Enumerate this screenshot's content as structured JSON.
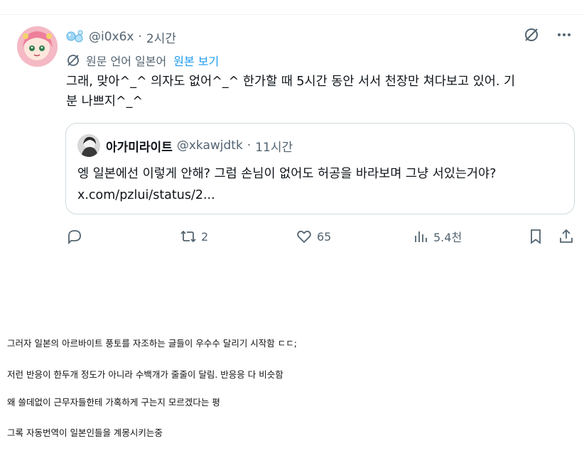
{
  "tweet": {
    "handle": "@i0x6x",
    "separator": "·",
    "time": "2시간",
    "translation": {
      "label": "원문 언어 일본어",
      "show_original": "원본 보기"
    },
    "text": "그래, 맞아^_^ 의자도 없어^_^ 한가할 때 5시간 동안 서서 천장만 쳐다보고 있어. 기\n분 나쁘지^_^",
    "quote": {
      "name": "아가미라이트",
      "handle": "@xkawjdtk",
      "separator": "·",
      "time": "11시간",
      "text_line1": "엥 일본에선 이렇게 안해? 그럼 손님이 없어도 허공을 바라보며 그냥 서있는거야?",
      "text_line2": "x.com/pzlui/status/2..."
    },
    "actions": {
      "reply_count": "",
      "retweet_count": "2",
      "like_count": "65",
      "view_count": "5.4천"
    }
  },
  "caption": {
    "lines": [
      "그러자 일본의 아르바이트 풍토를 자조하는 글들이 우수수 달리기 시작함 ㄷㄷ;",
      "저런 반응이 한두개 정도가 아니라 수백개가 줄줄이 달림. 반응응 다 비슷함",
      "왜 쓸데없이 근무자들한테 가혹하게 구는지 모르겠다는 평",
      "그록 자동번역이 일본인들을 계몽시키는중"
    ]
  },
  "icons": {
    "name_emoji": "bubbles-icon",
    "no_translate": "translate-off-icon",
    "more": "more-icon",
    "globe": "translate-icon",
    "reply": "reply-icon",
    "retweet": "retweet-icon",
    "like": "heart-icon",
    "views": "views-icon",
    "bookmark": "bookmark-icon",
    "share": "share-icon"
  },
  "colors": {
    "accent": "#1d9bf0",
    "secondary_text": "#536471",
    "border": "#cfd9de"
  }
}
